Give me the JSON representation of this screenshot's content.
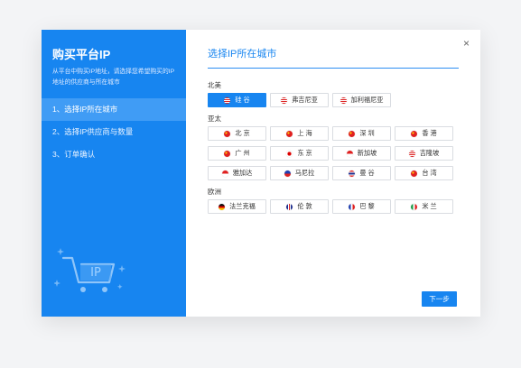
{
  "left_panel": {
    "title": "购买平台IP",
    "description": "从平台中购买IP地址，请选择您希望购买的IP地址的供应商与所在城市",
    "illustration_text": "IP",
    "steps": [
      {
        "label": "1、选择IP所在城市",
        "active": true
      },
      {
        "label": "2、选择IP供应商与数量",
        "active": false
      },
      {
        "label": "3、订单确认",
        "active": false
      }
    ]
  },
  "main": {
    "close_icon": "×",
    "heading": "选择IP所在城市",
    "next_button": "下一步",
    "colors": {
      "accent": "#1785f0",
      "chip_border": "#d9dce1"
    },
    "regions": [
      {
        "label": "北美",
        "rows": [
          [
            {
              "name": "硅 谷",
              "flag": "us-flag",
              "selected": true
            },
            {
              "name": "弗吉尼亚",
              "flag": "us-flag",
              "selected": false
            },
            {
              "name": "加利福尼亚",
              "flag": "us-flag",
              "selected": false
            }
          ]
        ]
      },
      {
        "label": "亚太",
        "rows": [
          [
            {
              "name": "北 京",
              "flag": "cn-flag",
              "selected": false
            },
            {
              "name": "上 海",
              "flag": "cn-flag",
              "selected": false
            },
            {
              "name": "深 圳",
              "flag": "cn-flag",
              "selected": false
            },
            {
              "name": "香 港",
              "flag": "cn-flag",
              "selected": false
            }
          ],
          [
            {
              "name": "广 州",
              "flag": "cn-flag",
              "selected": false
            },
            {
              "name": "东 京",
              "flag": "jp-flag",
              "selected": false
            },
            {
              "name": "新加坡",
              "flag": "sg-flag",
              "selected": false
            },
            {
              "name": "吉隆坡",
              "flag": "my-flag",
              "selected": false
            }
          ],
          [
            {
              "name": "雅加达",
              "flag": "id-flag",
              "selected": false
            },
            {
              "name": "马尼拉",
              "flag": "ph-flag",
              "selected": false
            },
            {
              "name": "曼 谷",
              "flag": "th-flag",
              "selected": false
            },
            {
              "name": "台 湾",
              "flag": "cn-flag",
              "selected": false
            }
          ]
        ]
      },
      {
        "label": "欧洲",
        "rows": [
          [
            {
              "name": "法兰克福",
              "flag": "de-flag",
              "selected": false
            },
            {
              "name": "伦 敦",
              "flag": "gb-flag",
              "selected": false
            },
            {
              "name": "巴 黎",
              "flag": "fr-flag",
              "selected": false
            },
            {
              "name": "米 兰",
              "flag": "it-flag",
              "selected": false
            }
          ]
        ]
      }
    ]
  }
}
